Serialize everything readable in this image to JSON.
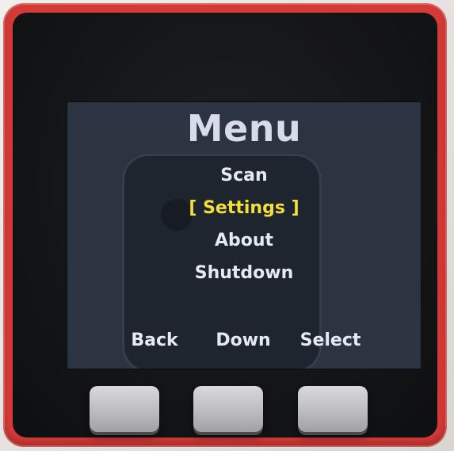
{
  "screen": {
    "title": "Menu",
    "items": [
      {
        "label": "Scan",
        "selected": false
      },
      {
        "label": "[ Settings ]",
        "selected": true
      },
      {
        "label": "About",
        "selected": false
      },
      {
        "label": "Shutdown",
        "selected": false
      }
    ],
    "soft_keys": {
      "left": "Back",
      "center": "Down",
      "right": "Select"
    }
  },
  "colors": {
    "case": "#d63a37",
    "screen_background": "#2c3442",
    "menu_text": "#e6e9f2",
    "selected_text": "#f2df3a"
  }
}
